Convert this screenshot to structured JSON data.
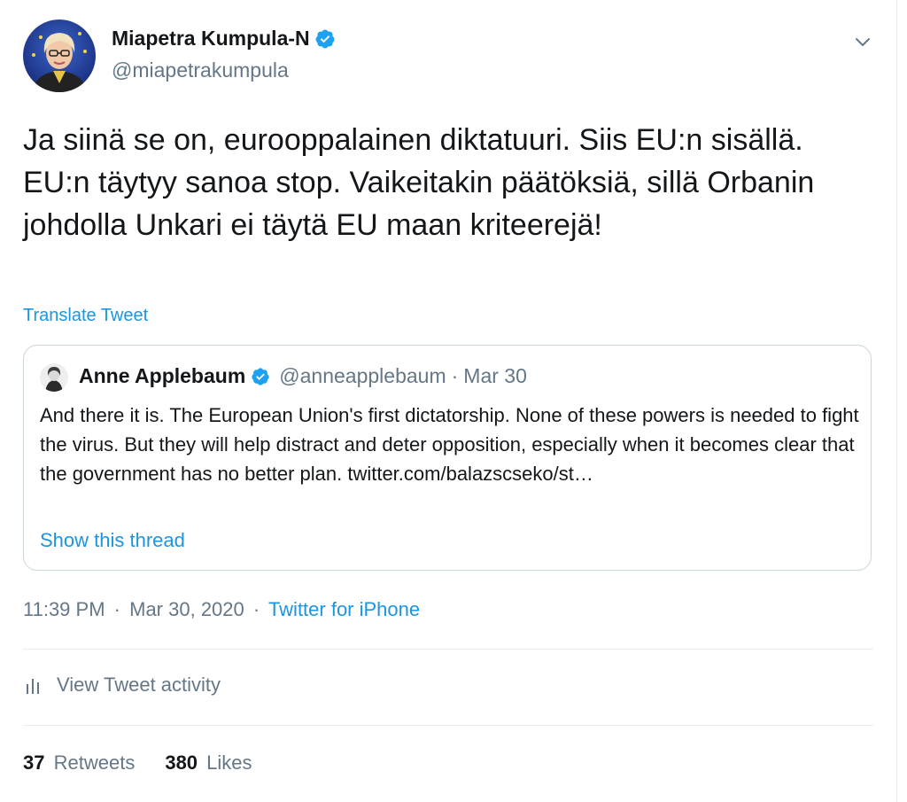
{
  "author": {
    "display_name": "Miapetra Kumpula-N",
    "handle": "@miapetrakumpula"
  },
  "tweet": {
    "text": "Ja siinä se on, eurooppalainen diktatuuri. Siis EU:n sisällä. EU:n täytyy sanoa stop. Vaikeitakin päätöksiä, sillä Orbanin johdolla Unkari ei täytä EU maan kriteerejä!",
    "translate_label": "Translate Tweet"
  },
  "quoted": {
    "display_name": "Anne Applebaum",
    "handle": "@anneapplebaum",
    "separator": "·",
    "date": "Mar 30",
    "text": "And there it is. The European Union's first dictatorship. None of these powers is needed to fight the virus. But they will help distract and deter opposition, especially when it becomes clear that the government has no better plan. twitter.com/balazscseko/st…",
    "show_thread_label": "Show this thread"
  },
  "meta": {
    "time": "11:39 PM",
    "separator1": "·",
    "date": "Mar 30, 2020",
    "separator2": "·",
    "source": "Twitter for iPhone"
  },
  "activity": {
    "label": "View Tweet activity"
  },
  "stats": {
    "retweets_count": "37",
    "retweets_label": "Retweets",
    "likes_count": "380",
    "likes_label": "Likes"
  },
  "colors": {
    "link": "#1b95e0",
    "verified": "#1da1f2",
    "muted": "#657786",
    "border": "#e6ecf0"
  },
  "icons": {
    "verified": "verified-badge-icon",
    "caret": "chevron-down-icon",
    "activity": "bar-chart-icon"
  }
}
